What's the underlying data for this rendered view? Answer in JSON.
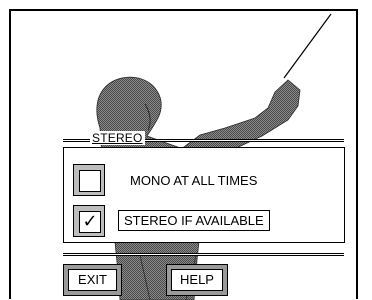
{
  "stereo_group": {
    "label": "STEREO",
    "options": [
      {
        "label": "MONO AT ALL TIMES",
        "checked": false,
        "check_glyph": ""
      },
      {
        "label": "STEREO IF AVAILABLE",
        "checked": true,
        "check_glyph": "✓"
      }
    ]
  },
  "buttons": {
    "exit": "EXIT",
    "help": "HELP"
  },
  "colors": {
    "background": "#ffffff",
    "silhouette_fill": "#777777",
    "checkbox_frame": "#bdbdbd",
    "button_frame": "#9a9a9a",
    "border": "#000000"
  },
  "icons": [
    "conductor-silhouette",
    "check-mark-icon"
  ]
}
